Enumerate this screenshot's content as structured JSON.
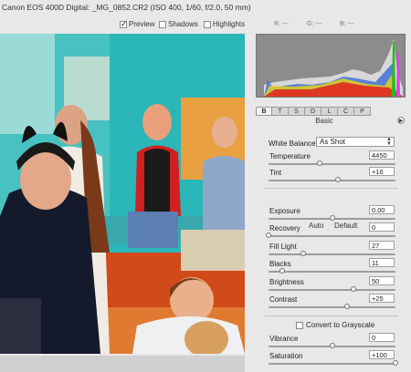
{
  "window": {
    "title": "Canon EOS 400D Digital:  _MG_0852.CR2  (ISO 400, 1/60, f/2.0, 50 mm)"
  },
  "toolbar": {
    "preview": {
      "label": "Preview",
      "checked": true
    },
    "shadows": {
      "label": "Shadows",
      "checked": false
    },
    "highlights": {
      "label": "Highlights",
      "checked": false
    },
    "r_label": "R:  ---",
    "g_label": "G:  ---",
    "b_label": "B:  ---"
  },
  "histogram": {
    "icon": "histogram"
  },
  "panel": {
    "tabs": [
      "B",
      "T",
      "S",
      "D",
      "L",
      "C",
      "P"
    ],
    "active_tab": "B",
    "title": "Basic",
    "menu_icon": "triangle-right-icon",
    "white_balance": {
      "label": "White Balance:",
      "value": "As Shot"
    },
    "auto_label": "Auto",
    "default_label": "Default",
    "convert_grayscale": {
      "label": "Convert to Grayscale",
      "checked": false
    },
    "sliders": {
      "temperature": {
        "label": "Temperature",
        "value": "4450",
        "position": 0.4
      },
      "tint": {
        "label": "Tint",
        "value": "+16",
        "position": 0.55
      },
      "exposure": {
        "label": "Exposure",
        "value": "0.00",
        "position": 0.5
      },
      "recovery": {
        "label": "Recovery",
        "value": "0",
        "position": 0.0
      },
      "fill_light": {
        "label": "Fill Light",
        "value": "27",
        "position": 0.27
      },
      "blacks": {
        "label": "Blacks",
        "value": "11",
        "position": 0.11
      },
      "brightness": {
        "label": "Brightness",
        "value": "50",
        "position": 0.67
      },
      "contrast": {
        "label": "Contrast",
        "value": "+25",
        "position": 0.62
      },
      "vibrance": {
        "label": "Vibrance",
        "value": "0",
        "position": 0.5
      },
      "saturation": {
        "label": "Saturation",
        "value": "+100",
        "position": 1.0
      }
    }
  },
  "colors": {
    "background": "#e8e8e8",
    "teal_wall": "#2bb6b8"
  }
}
